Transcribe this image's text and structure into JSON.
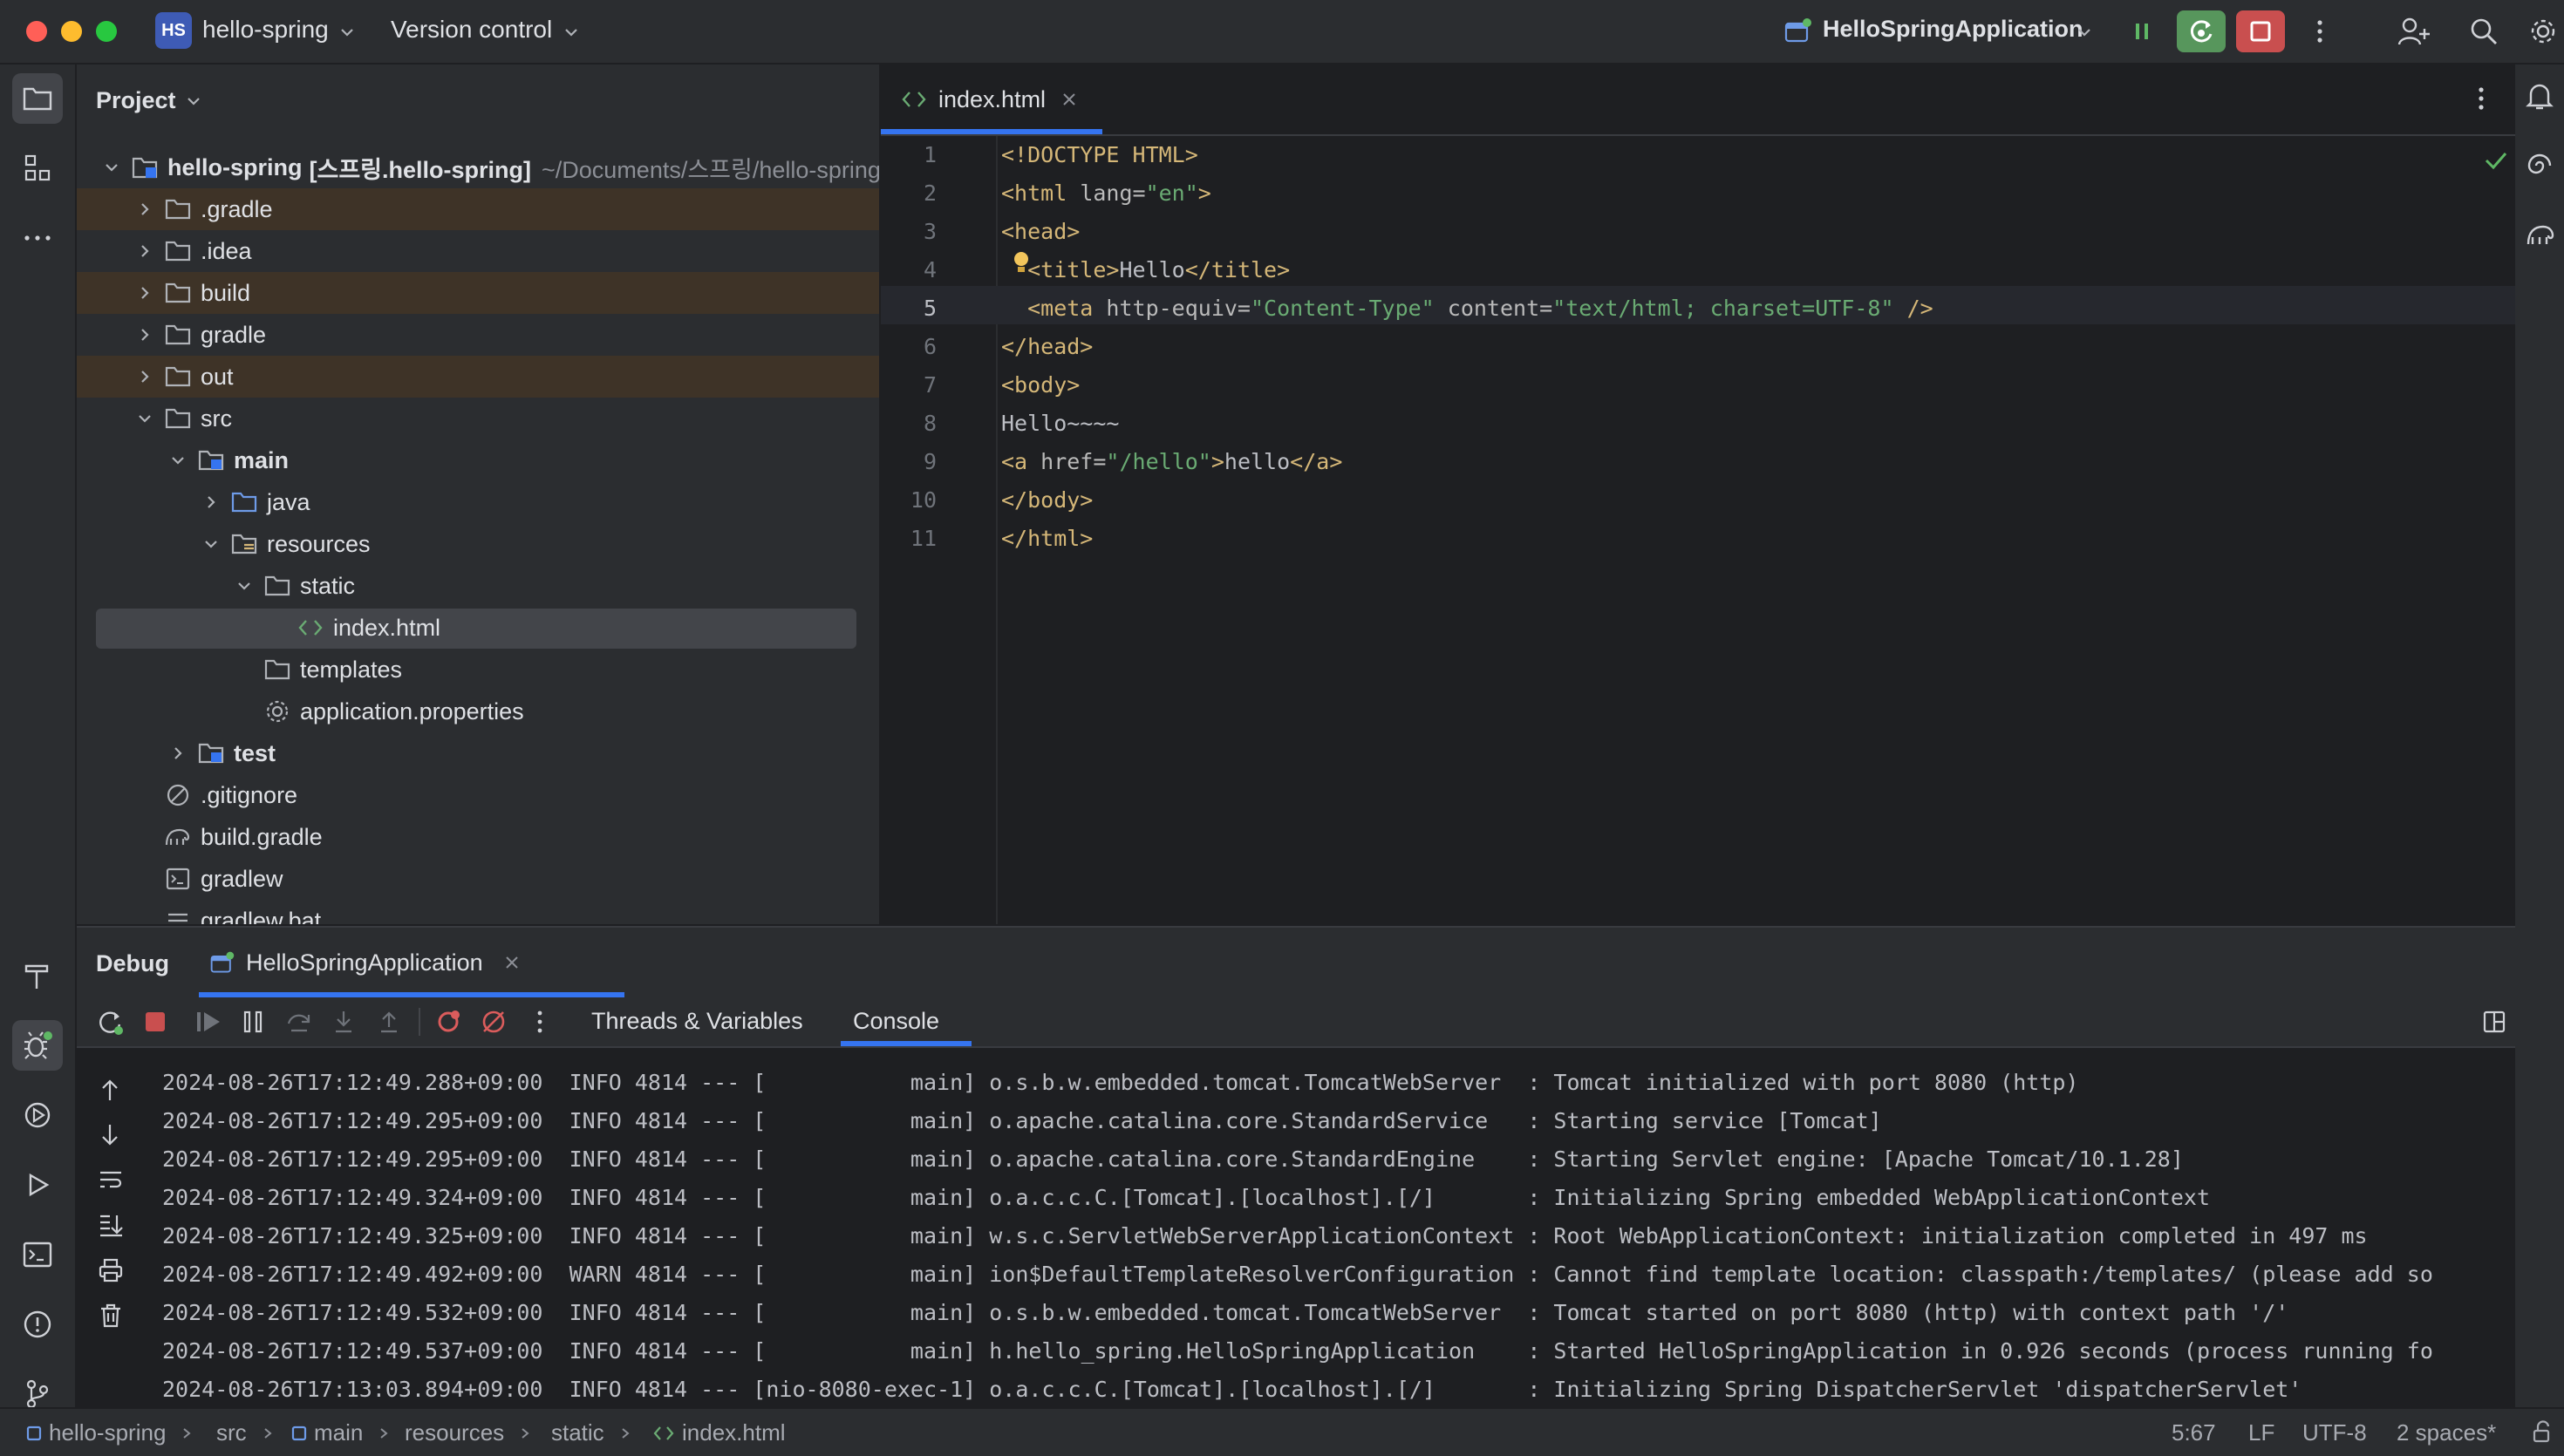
{
  "titlebar": {
    "project_badge": "HS",
    "project_name": "hello-spring",
    "vcs_label": "Version control",
    "run_config": "HelloSpringApplication"
  },
  "project_panel": {
    "title": "Project",
    "root_name": "hello-spring",
    "root_module": "[스프링.hello-spring]",
    "root_path": "~/Documents/스프링/hello-spring",
    "items": [
      {
        "label": ".gradle"
      },
      {
        "label": ".idea"
      },
      {
        "label": "build"
      },
      {
        "label": "gradle"
      },
      {
        "label": "out"
      },
      {
        "label": "src"
      },
      {
        "label": "main"
      },
      {
        "label": "java"
      },
      {
        "label": "resources"
      },
      {
        "label": "static"
      },
      {
        "label": "index.html"
      },
      {
        "label": "templates"
      },
      {
        "label": "application.properties"
      },
      {
        "label": "test"
      },
      {
        "label": ".gitignore"
      },
      {
        "label": "build.gradle"
      },
      {
        "label": "gradlew"
      },
      {
        "label": "gradlew.bat"
      }
    ]
  },
  "editor": {
    "tab_label": "index.html",
    "lines": [
      {
        "n": "1",
        "parts": [
          {
            "c": "t-tag",
            "t": "<!DOCTYPE HTML>"
          }
        ]
      },
      {
        "n": "2",
        "parts": [
          {
            "c": "t-tag",
            "t": "<html "
          },
          {
            "c": "t-attr",
            "t": "lang="
          },
          {
            "c": "t-str",
            "t": "\"en\""
          },
          {
            "c": "t-tag",
            "t": ">"
          }
        ]
      },
      {
        "n": "3",
        "parts": [
          {
            "c": "t-tag",
            "t": "<head>"
          }
        ]
      },
      {
        "n": "4",
        "parts": [
          {
            "c": "t-tag",
            "t": "  <title>"
          },
          {
            "c": "t-txt",
            "t": "Hello"
          },
          {
            "c": "t-tag",
            "t": "</title>"
          }
        ]
      },
      {
        "n": "5",
        "parts": [
          {
            "c": "t-tag",
            "t": "  <meta "
          },
          {
            "c": "t-attr",
            "t": "http-equiv="
          },
          {
            "c": "t-str",
            "t": "\"Content-Type\""
          },
          {
            "c": "t-attr",
            "t": " content="
          },
          {
            "c": "t-str",
            "t": "\"text/html; charset=UTF-8\""
          },
          {
            "c": "t-tag",
            "t": " />"
          }
        ]
      },
      {
        "n": "6",
        "parts": [
          {
            "c": "t-tag",
            "t": "</head>"
          }
        ]
      },
      {
        "n": "7",
        "parts": [
          {
            "c": "t-tag",
            "t": "<body>"
          }
        ]
      },
      {
        "n": "8",
        "parts": [
          {
            "c": "t-txt",
            "t": "Hello~~~~"
          }
        ]
      },
      {
        "n": "9",
        "parts": [
          {
            "c": "t-tag",
            "t": "<a "
          },
          {
            "c": "t-attr",
            "t": "href="
          },
          {
            "c": "t-str",
            "t": "\"/hello\""
          },
          {
            "c": "t-tag",
            "t": ">"
          },
          {
            "c": "t-txt",
            "t": "hello"
          },
          {
            "c": "t-tag",
            "t": "</a>"
          }
        ]
      },
      {
        "n": "10",
        "parts": [
          {
            "c": "t-tag",
            "t": "</body>"
          }
        ]
      },
      {
        "n": "11",
        "parts": [
          {
            "c": "t-tag",
            "t": "</html>"
          }
        ]
      }
    ]
  },
  "debug": {
    "title": "Debug",
    "session_tab": "HelloSpringApplication",
    "tab_threads": "Threads & Variables",
    "tab_console": "Console",
    "log": [
      "2024-08-26T17:12:49.288+09:00  INFO 4814 --- [           main] o.s.b.w.embedded.tomcat.TomcatWebServer  : Tomcat initialized with port 8080 (http)",
      "2024-08-26T17:12:49.295+09:00  INFO 4814 --- [           main] o.apache.catalina.core.StandardService   : Starting service [Tomcat]",
      "2024-08-26T17:12:49.295+09:00  INFO 4814 --- [           main] o.apache.catalina.core.StandardEngine    : Starting Servlet engine: [Apache Tomcat/10.1.28]",
      "2024-08-26T17:12:49.324+09:00  INFO 4814 --- [           main] o.a.c.c.C.[Tomcat].[localhost].[/]       : Initializing Spring embedded WebApplicationContext",
      "2024-08-26T17:12:49.325+09:00  INFO 4814 --- [           main] w.s.c.ServletWebServerApplicationContext : Root WebApplicationContext: initialization completed in 497 ms",
      "2024-08-26T17:12:49.492+09:00  WARN 4814 --- [           main] ion$DefaultTemplateResolverConfiguration : Cannot find template location: classpath:/templates/ (please add so",
      "2024-08-26T17:12:49.532+09:00  INFO 4814 --- [           main] o.s.b.w.embedded.tomcat.TomcatWebServer  : Tomcat started on port 8080 (http) with context path '/'",
      "2024-08-26T17:12:49.537+09:00  INFO 4814 --- [           main] h.hello_spring.HelloSpringApplication    : Started HelloSpringApplication in 0.926 seconds (process running fo",
      "2024-08-26T17:13:03.894+09:00  INFO 4814 --- [nio-8080-exec-1] o.a.c.c.C.[Tomcat].[localhost].[/]       : Initializing Spring DispatcherServlet 'dispatcherServlet'"
    ]
  },
  "statusbar": {
    "crumbs": [
      "hello-spring",
      "src",
      "main",
      "resources",
      "static",
      "index.html"
    ],
    "position": "5:67",
    "line_sep": "LF",
    "encoding": "UTF-8",
    "indent": "2 spaces*"
  },
  "colors": {
    "accent": "#3574f0",
    "folder_excluded_bg": "#3e3327",
    "run_green": "#57965c",
    "stop_red": "#c94f4f"
  }
}
